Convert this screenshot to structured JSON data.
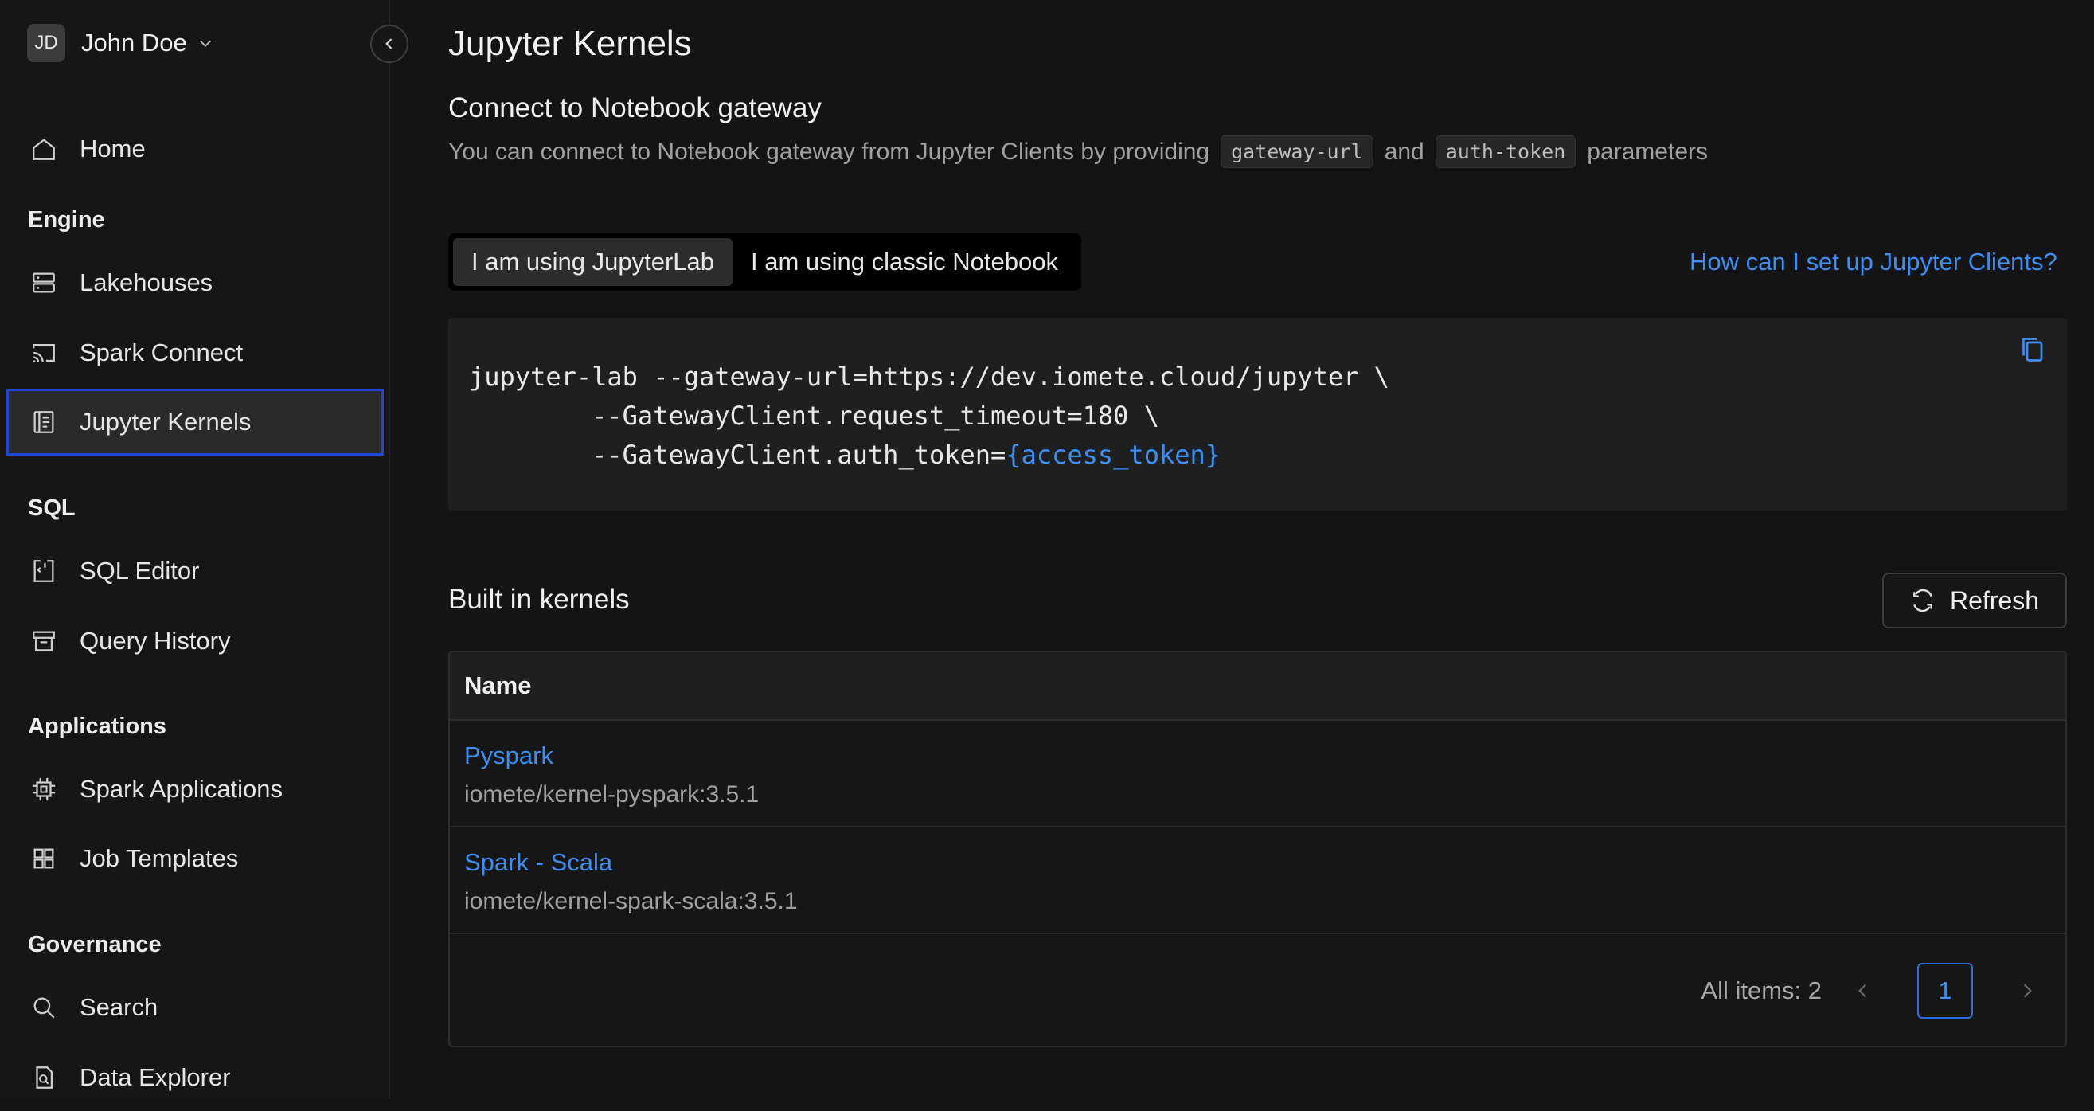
{
  "user": {
    "initials": "JD",
    "name": "John Doe"
  },
  "sidebar": {
    "home": {
      "label": "Home"
    },
    "sections": {
      "engine": "Engine",
      "sql": "SQL",
      "applications": "Applications",
      "governance": "Governance"
    },
    "items": {
      "lakehouses": "Lakehouses",
      "spark_connect": "Spark Connect",
      "jupyter_kernels": "Jupyter Kernels",
      "sql_editor": "SQL Editor",
      "query_history": "Query History",
      "spark_applications": "Spark Applications",
      "job_templates": "Job Templates",
      "search": "Search",
      "data_explorer": "Data Explorer"
    },
    "active_item": "Jupyter Kernels"
  },
  "page": {
    "title": "Jupyter Kernels",
    "connect_title": "Connect to Notebook gateway",
    "desc_prefix": "You can connect to Notebook gateway from Jupyter Clients by providing",
    "desc_param1": "gateway-url",
    "desc_and": "and",
    "desc_param2": "auth-token",
    "desc_suffix": "parameters",
    "tabs": [
      {
        "label": "I am using JupyterLab",
        "active": true
      },
      {
        "label": "I am using classic Notebook",
        "active": false
      }
    ],
    "help_link": "How can I set up Jupyter Clients?",
    "code": {
      "line1": "jupyter-lab --gateway-url=https://dev.iomete.cloud/jupyter \\",
      "line2": "        --GatewayClient.request_timeout=180 \\",
      "line3_prefix": "        --GatewayClient.auth_token=",
      "line3_token": "{access_token}"
    },
    "builtin_title": "Built in kernels",
    "refresh_label": "Refresh",
    "table": {
      "column_name": "Name",
      "rows": [
        {
          "name": "Pyspark",
          "image": "iomete/kernel-pyspark:3.5.1"
        },
        {
          "name": "Spark - Scala",
          "image": "iomete/kernel-spark-scala:3.5.1"
        }
      ],
      "all_items": "All items: 2",
      "current_page": "1"
    }
  },
  "colors": {
    "accent_link": "#3c8ef0",
    "active_border": "#1f45d8",
    "background": "#141414"
  }
}
